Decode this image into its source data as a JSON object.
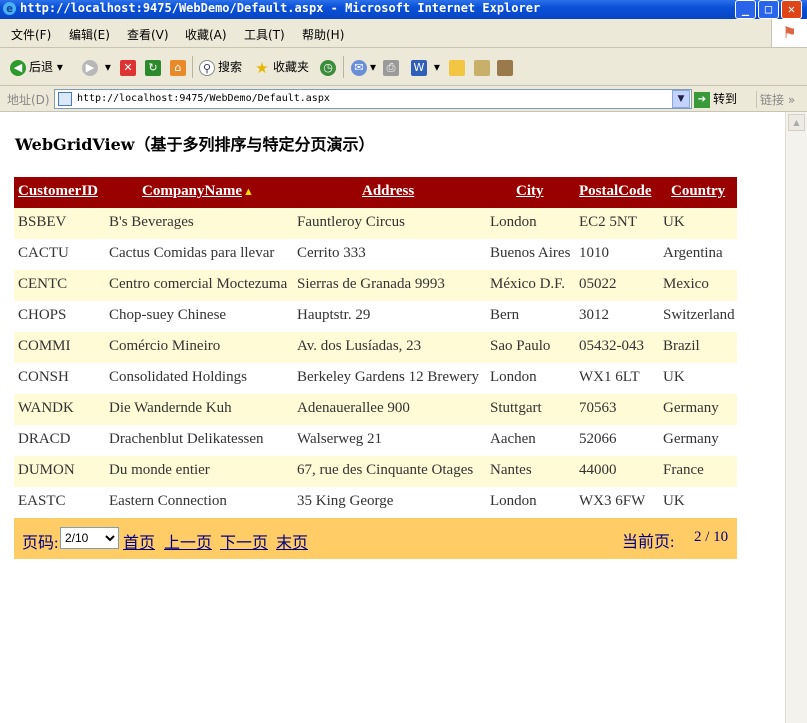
{
  "window": {
    "title": "http://localhost:9475/WebDemo/Default.aspx - Microsoft Internet Explorer",
    "minimize_glyph": "_",
    "maximize_glyph": "□",
    "close_glyph": "✕"
  },
  "menu": {
    "items": [
      "文件(F)",
      "编辑(E)",
      "查看(V)",
      "收藏(A)",
      "工具(T)",
      "帮助(H)"
    ]
  },
  "toolbar": {
    "back_label": "后退",
    "search_label": "搜索",
    "favorites_label": "收藏夹"
  },
  "address": {
    "label": "地址(D)",
    "url": "http://localhost:9475/WebDemo/Default.aspx",
    "go_label": "转到",
    "links_label": "链接"
  },
  "page": {
    "title": "WebGridView（基于多列排序与特定分页演示）"
  },
  "grid": {
    "columns": [
      "CustomerID",
      "CompanyName",
      "Address",
      "City",
      "PostalCode",
      "Country"
    ],
    "sorted_column": "CompanyName",
    "sort_direction": "ascending",
    "rows": [
      [
        "BSBEV",
        "B's Beverages",
        "Fauntleroy Circus",
        "London",
        "EC2 5NT",
        "UK"
      ],
      [
        "CACTU",
        "Cactus Comidas para llevar",
        "Cerrito 333",
        "Buenos Aires",
        "1010",
        "Argentina"
      ],
      [
        "CENTC",
        "Centro comercial Moctezuma",
        "Sierras de Granada 9993",
        "México D.F.",
        "05022",
        "Mexico"
      ],
      [
        "CHOPS",
        "Chop-suey Chinese",
        "Hauptstr. 29",
        "Bern",
        "3012",
        "Switzerland"
      ],
      [
        "COMMI",
        "Comércio Mineiro",
        "Av. dos Lusíadas, 23",
        "Sao Paulo",
        "05432-043",
        "Brazil"
      ],
      [
        "CONSH",
        "Consolidated Holdings",
        "Berkeley Gardens 12 Brewery",
        "London",
        "WX1 6LT",
        "UK"
      ],
      [
        "WANDK",
        "Die Wandernde Kuh",
        "Adenauerallee 900",
        "Stuttgart",
        "70563",
        "Germany"
      ],
      [
        "DRACD",
        "Drachenblut Delikatessen",
        "Walserweg 21",
        "Aachen",
        "52066",
        "Germany"
      ],
      [
        "DUMON",
        "Du monde entier",
        "67, rue des Cinquante Otages",
        "Nantes",
        "44000",
        "France"
      ],
      [
        "EASTC",
        "Eastern Connection",
        "35 King George",
        "London",
        "WX3 6FW",
        "UK"
      ]
    ]
  },
  "pager": {
    "page_label": "页码:",
    "selected_page": "2/10",
    "first": "首页",
    "prev": "上一页",
    "next": "下一页",
    "last": "末页",
    "current_label": "当前页:",
    "current_value": "2 / 10"
  },
  "colors": {
    "header_bg": "#990000",
    "odd_row_bg": "#fffbd6",
    "pager_bg": "#ffcc66",
    "pager_text": "#000080"
  }
}
